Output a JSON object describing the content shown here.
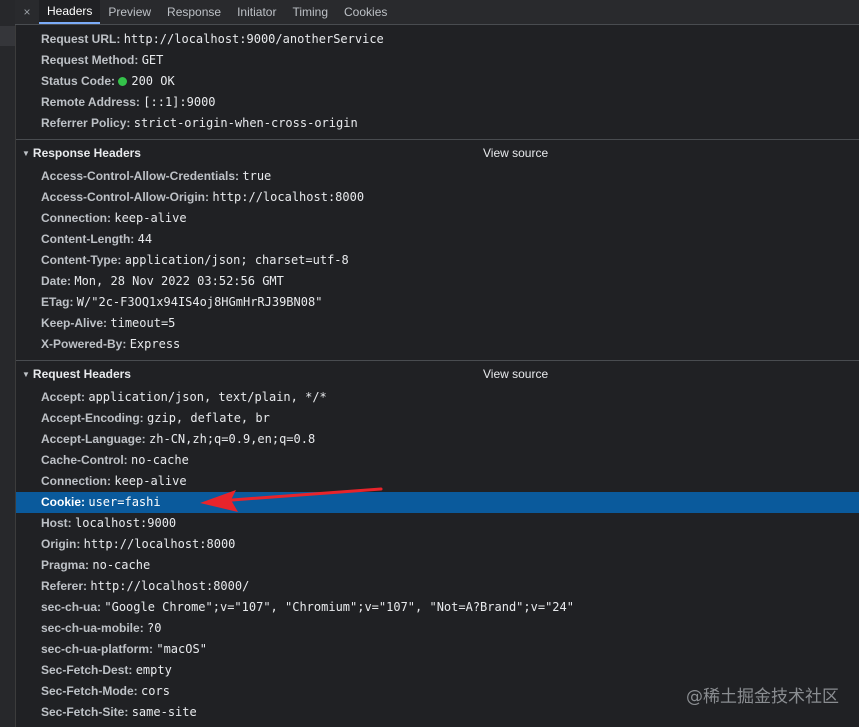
{
  "tabs": {
    "close": "×",
    "items": [
      "Headers",
      "Preview",
      "Response",
      "Initiator",
      "Timing",
      "Cookies"
    ]
  },
  "general": [
    {
      "k": "Request URL:",
      "v": "http://localhost:9000/anotherService"
    },
    {
      "k": "Request Method:",
      "v": "GET"
    },
    {
      "k": "Status Code:",
      "v": "200 OK",
      "status_color": "#34c24a"
    },
    {
      "k": "Remote Address:",
      "v": "[::1]:9000"
    },
    {
      "k": "Referrer Policy:",
      "v": "strict-origin-when-cross-origin"
    }
  ],
  "response_headers": {
    "title": "Response Headers",
    "view_source": "View source",
    "items": [
      {
        "k": "Access-Control-Allow-Credentials:",
        "v": "true"
      },
      {
        "k": "Access-Control-Allow-Origin:",
        "v": "http://localhost:8000"
      },
      {
        "k": "Connection:",
        "v": "keep-alive"
      },
      {
        "k": "Content-Length:",
        "v": "44"
      },
      {
        "k": "Content-Type:",
        "v": "application/json; charset=utf-8"
      },
      {
        "k": "Date:",
        "v": "Mon, 28 Nov 2022 03:52:56 GMT"
      },
      {
        "k": "ETag:",
        "v": "W/\"2c-F3OQ1x94IS4oj8HGmHrRJ39BN08\""
      },
      {
        "k": "Keep-Alive:",
        "v": "timeout=5"
      },
      {
        "k": "X-Powered-By:",
        "v": "Express"
      }
    ]
  },
  "request_headers": {
    "title": "Request Headers",
    "view_source": "View source",
    "items": [
      {
        "k": "Accept:",
        "v": "application/json, text/plain, */*"
      },
      {
        "k": "Accept-Encoding:",
        "v": "gzip, deflate, br"
      },
      {
        "k": "Accept-Language:",
        "v": "zh-CN,zh;q=0.9,en;q=0.8"
      },
      {
        "k": "Cache-Control:",
        "v": "no-cache"
      },
      {
        "k": "Connection:",
        "v": "keep-alive"
      },
      {
        "k": "Cookie:",
        "v": "user=fashi",
        "highlighted": true
      },
      {
        "k": "Host:",
        "v": "localhost:9000"
      },
      {
        "k": "Origin:",
        "v": "http://localhost:8000"
      },
      {
        "k": "Pragma:",
        "v": "no-cache"
      },
      {
        "k": "Referer:",
        "v": "http://localhost:8000/"
      },
      {
        "k": "sec-ch-ua:",
        "v": "\"Google Chrome\";v=\"107\", \"Chromium\";v=\"107\", \"Not=A?Brand\";v=\"24\""
      },
      {
        "k": "sec-ch-ua-mobile:",
        "v": "?0"
      },
      {
        "k": "sec-ch-ua-platform:",
        "v": "\"macOS\""
      },
      {
        "k": "Sec-Fetch-Dest:",
        "v": "empty"
      },
      {
        "k": "Sec-Fetch-Mode:",
        "v": "cors"
      },
      {
        "k": "Sec-Fetch-Site:",
        "v": "same-site"
      }
    ]
  },
  "annotation_color": "#e8242b",
  "watermark": "@稀土掘金技术社区"
}
